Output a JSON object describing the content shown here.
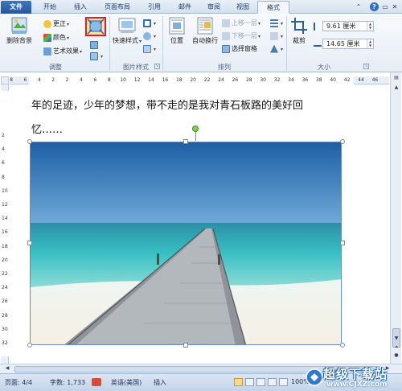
{
  "tabs": [
    {
      "label": "文件"
    },
    {
      "label": "开始"
    },
    {
      "label": "插入"
    },
    {
      "label": "页面布局"
    },
    {
      "label": "引用"
    },
    {
      "label": "邮件"
    },
    {
      "label": "审阅"
    },
    {
      "label": "视图"
    },
    {
      "label": "格式",
      "active": true
    }
  ],
  "ribbon": {
    "adjust": {
      "remove_background": "删除背景",
      "corrections": "更正",
      "color": "颜色",
      "artistic_effects": "艺术效果",
      "group_label": "调整"
    },
    "picture_styles": {
      "quick_styles": "快速样式",
      "group_label": "图片样式"
    },
    "arrange": {
      "position": "位置",
      "wrap_text": "自动换行",
      "bring_forward": "上移一层",
      "send_backward": "下移一层",
      "selection_pane": "选择窗格",
      "group_label": "排列"
    },
    "size": {
      "crop": "裁剪",
      "height_value": "9.61 厘米",
      "width_value": "14.65 厘米",
      "group_label": "大小"
    }
  },
  "ruler": {
    "h_ticks": [
      "8",
      "6",
      "4",
      "2",
      "2",
      "4",
      "6",
      "8",
      "10",
      "12",
      "14",
      "16",
      "18",
      "20",
      "22",
      "24",
      "26",
      "28",
      "30",
      "32",
      "34",
      "36",
      "38",
      "40",
      "42",
      "44",
      "46"
    ],
    "v_ticks": [
      "2",
      "4",
      "6",
      "8",
      "10",
      "12",
      "14",
      "16",
      "18",
      "20",
      "22",
      "24",
      "26",
      "28",
      "30",
      "32"
    ]
  },
  "document": {
    "line1": "年的足迹，少年的梦想，带不走的是我对青石板路的美好回",
    "line2": "忆……"
  },
  "status": {
    "page": "页面: 4/4",
    "words": "字数: 1,733",
    "language": "英语(美国)",
    "mode": "插入",
    "zoom": "100%"
  },
  "watermark": {
    "main": "超级下载站",
    "sub": "www.CJXZ.com"
  },
  "colors": {
    "file_tab": "#2b62ad",
    "accent": "#d6232a",
    "ribbon_bg": "#eaf0f7"
  }
}
